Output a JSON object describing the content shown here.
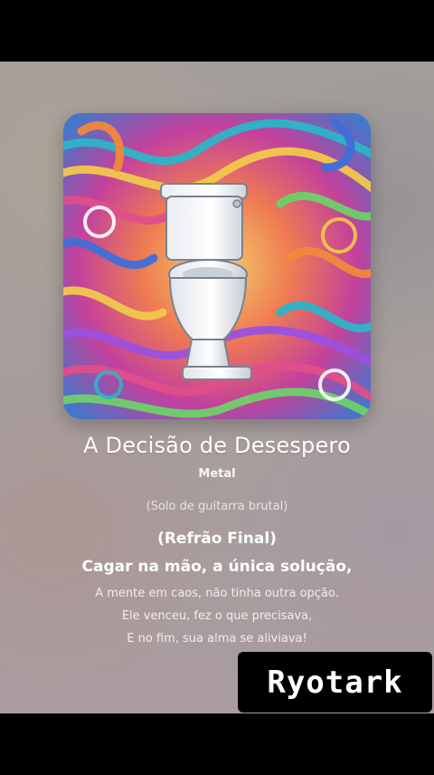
{
  "song": {
    "title": "A Decisão de Desespero",
    "genre": "Metal"
  },
  "cover": {
    "image_name": "toilet-psychedelic-swirl-artwork"
  },
  "lyrics": [
    "(Solo de guitarra brutal)",
    "(Refrão Final)",
    "Cagar na mão, a única solução,",
    "A mente em caos, não tinha outra opção.",
    "Ele venceu, fez o que precisava,",
    "E no fim, sua alma se aliviava!"
  ],
  "watermark": {
    "text": "Ryotark"
  },
  "colors": {
    "background": "#a69e9c",
    "text": "#ffffff",
    "letterbox": "#000000"
  }
}
